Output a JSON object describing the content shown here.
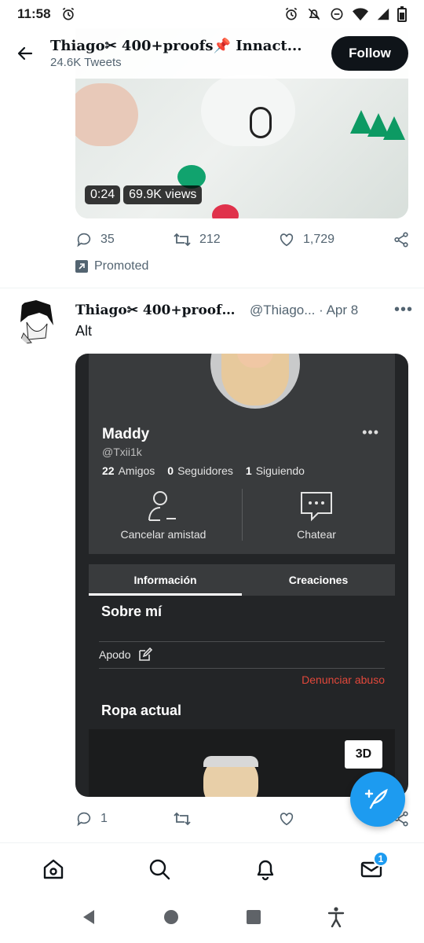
{
  "status_bar": {
    "time": "11:58",
    "icons": [
      "alarm-icon",
      "alarm-icon",
      "notifications-off-icon",
      "do-not-disturb-icon",
      "wifi-icon",
      "signal-icon",
      "battery-icon"
    ]
  },
  "header": {
    "title": "Thiago✂ 400+proofs📌 Innact...",
    "subtitle": "24.6K Tweets",
    "follow_label": "Follow"
  },
  "video": {
    "duration": "0:24",
    "views": "69.9K views"
  },
  "tweet1_actions": {
    "replies": "35",
    "retweets": "212",
    "likes": "1,729"
  },
  "promoted_label": "Promoted",
  "tweet2": {
    "display_name": "Thiago✂ 400+proofs...",
    "handle_date": "@Thiago... · Apr 8",
    "text": "Alt",
    "replies": "1"
  },
  "roblox_profile": {
    "name": "Maddy",
    "handle": "@Txii1k",
    "friends_count": "22",
    "friends_label": "Amigos",
    "followers_count": "0",
    "followers_label": "Seguidores",
    "following_count": "1",
    "following_label": "Siguiendo",
    "unfriend_label": "Cancelar amistad",
    "chat_label": "Chatear",
    "tab_info": "Información",
    "tab_creations": "Creaciones",
    "about_title": "Sobre mí",
    "nickname_label": "Apodo",
    "report_label": "Denunciar abuso",
    "outfit_title": "Ropa actual",
    "btn_3d": "3D"
  },
  "bottom_nav": {
    "messages_badge": "1"
  },
  "colors": {
    "accent": "#1d9bf0",
    "report_red": "#e2483b",
    "text_secondary": "#536471"
  }
}
